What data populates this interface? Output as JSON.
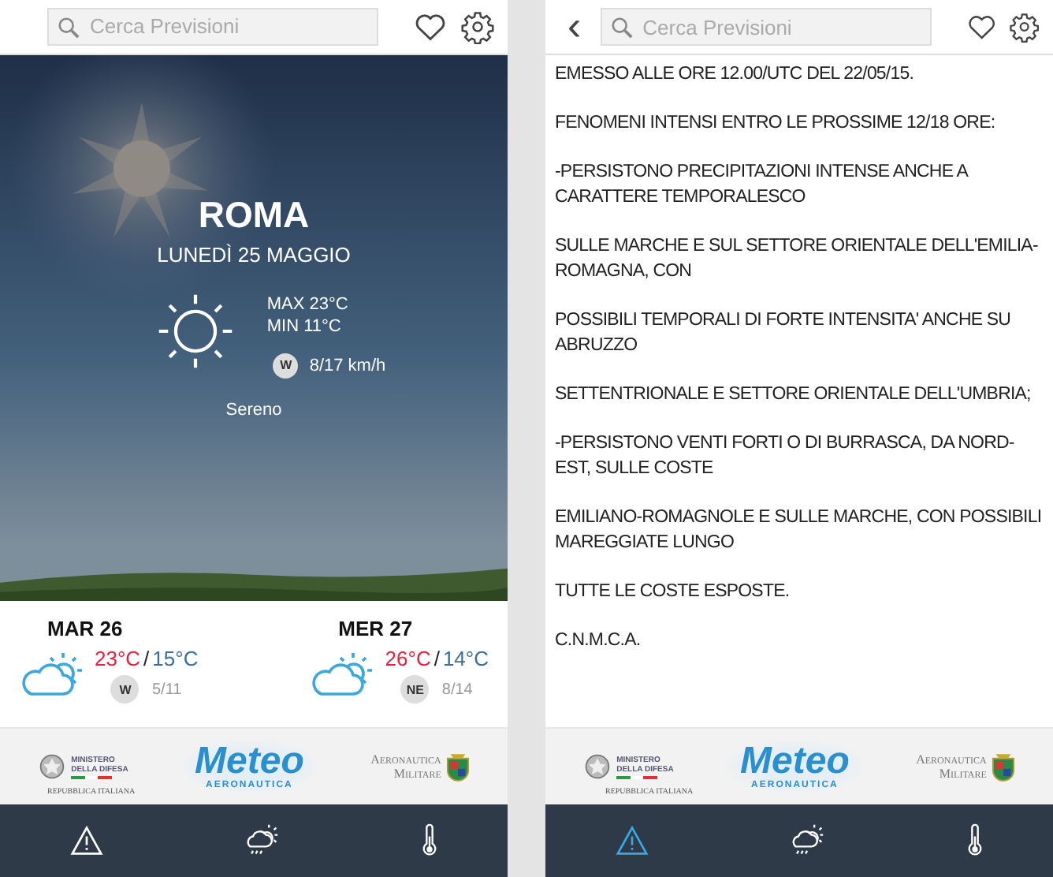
{
  "home": {
    "search": {
      "placeholder": "Cerca Previsioni"
    },
    "today": {
      "kind": "picture",
      "city": "ROMA",
      "date": "LUNEDÌ 25 MAGGIO",
      "max": "MAX 23°C",
      "min": "MIN 11°C",
      "wind_dir": "W",
      "wind": "8/17 km/h",
      "condition": "Sereno"
    },
    "days": [
      {
        "day": "MAR 26",
        "high": "23°C",
        "sep": "/",
        "low": "15°C",
        "wind_dir": "W",
        "wind": "5/11"
      },
      {
        "day": "MER 27",
        "high": "26°C",
        "sep": "/",
        "low": "14°C",
        "wind_dir": "NE",
        "wind": "8/14"
      }
    ],
    "footer": {
      "ministry_top": "MINISTERO",
      "ministry_mid": "DELLA DIFESA",
      "ministry_bottom": "REPUBBLICA ITALIANA",
      "meteo": "Meteo",
      "meteo_sub": "AERONAUTICA",
      "air_force_top": "Aeronautica",
      "air_force_bottom": "Militare"
    },
    "tabs": [
      {
        "kind": "warning",
        "selected": false
      },
      {
        "kind": "forecast",
        "selected": false
      },
      {
        "kind": "temperature",
        "selected": false
      }
    ]
  },
  "warning": {
    "back": "‹",
    "search": {
      "placeholder": "Cerca Previsioni"
    },
    "paragraphs": [
      "EMESSO ALLE ORE 12.00/UTC DEL 22/05/15.",
      "FENOMENI INTENSI ENTRO LE PROSSIME 12/18 ORE:",
      "-PERSISTONO PRECIPITAZIONI INTENSE ANCHE A CARATTERE TEMPORALESCO",
      "SULLE MARCHE E SUL SETTORE ORIENTALE DELL'EMILIA-ROMAGNA, CON",
      "POSSIBILI TEMPORALI DI FORTE INTENSITA' ANCHE SU ABRUZZO",
      "SETTENTRIONALE E SETTORE ORIENTALE DELL'UMBRIA;",
      "-PERSISTONO VENTI FORTI O DI BURRASCA, DA NORD-EST, SULLE COSTE",
      "EMILIANO-ROMAGNOLE E SULLE MARCHE, CON POSSIBILI MAREGGIATE LUNGO",
      "TUTTE LE COSTE ESPOSTE.",
      "C.N.M.C.A."
    ],
    "footer": {
      "ministry_top": "MINISTERO",
      "ministry_mid": "DELLA DIFESA",
      "ministry_bottom": "REPUBBLICA ITALIANA",
      "meteo": "Meteo",
      "meteo_sub": "AERONAUTICA",
      "air_force_top": "Aeronautica",
      "air_force_bottom": "Militare"
    },
    "tabs": [
      {
        "kind": "warning",
        "selected": true
      },
      {
        "kind": "forecast",
        "selected": false
      },
      {
        "kind": "temperature",
        "selected": false
      }
    ]
  }
}
